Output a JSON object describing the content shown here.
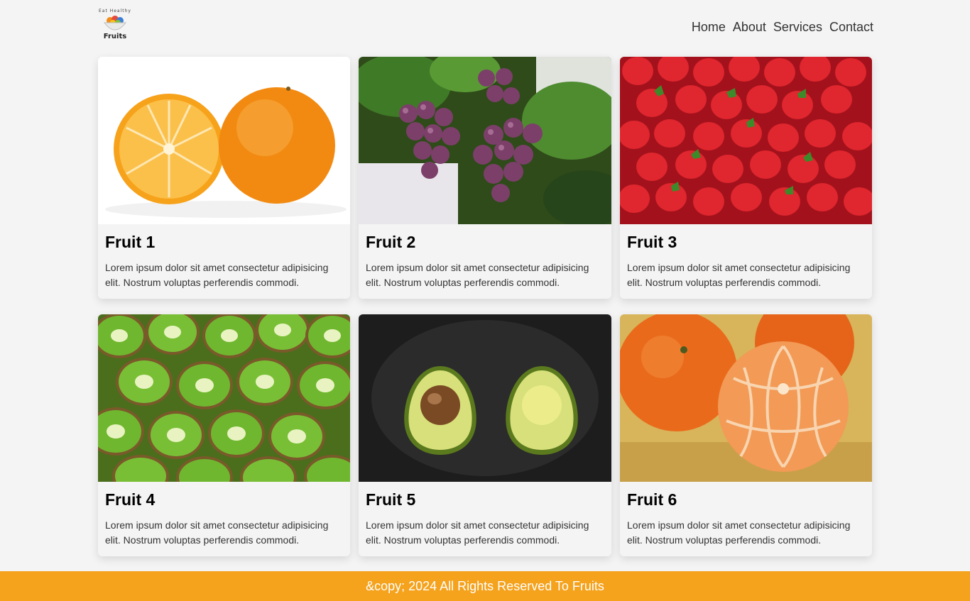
{
  "logo": {
    "tagline": "Eat Healthy",
    "name": "Fruits"
  },
  "nav": {
    "items": [
      "Home",
      "About",
      "Services",
      "Contact"
    ]
  },
  "cards": [
    {
      "title": "Fruit 1",
      "text": "Lorem ipsum dolor sit amet consectetur adipisicing elit. Nostrum voluptas perferendis commodi.",
      "image": "oranges"
    },
    {
      "title": "Fruit 2",
      "text": "Lorem ipsum dolor sit amet consectetur adipisicing elit. Nostrum voluptas perferendis commodi.",
      "image": "grapes"
    },
    {
      "title": "Fruit 3",
      "text": "Lorem ipsum dolor sit amet consectetur adipisicing elit. Nostrum voluptas perferendis commodi.",
      "image": "strawberries"
    },
    {
      "title": "Fruit 4",
      "text": "Lorem ipsum dolor sit amet consectetur adipisicing elit. Nostrum voluptas perferendis commodi.",
      "image": "kiwis"
    },
    {
      "title": "Fruit 5",
      "text": "Lorem ipsum dolor sit amet consectetur adipisicing elit. Nostrum voluptas perferendis commodi.",
      "image": "avocado"
    },
    {
      "title": "Fruit 6",
      "text": "Lorem ipsum dolor sit amet consectetur adipisicing elit. Nostrum voluptas perferendis commodi.",
      "image": "tangerines"
    }
  ],
  "footer": {
    "text": "&copy; 2024 All Rights Reserved To Fruits"
  },
  "colors": {
    "footer_bg": "#f5a21c",
    "page_bg": "#f4f4f4"
  }
}
